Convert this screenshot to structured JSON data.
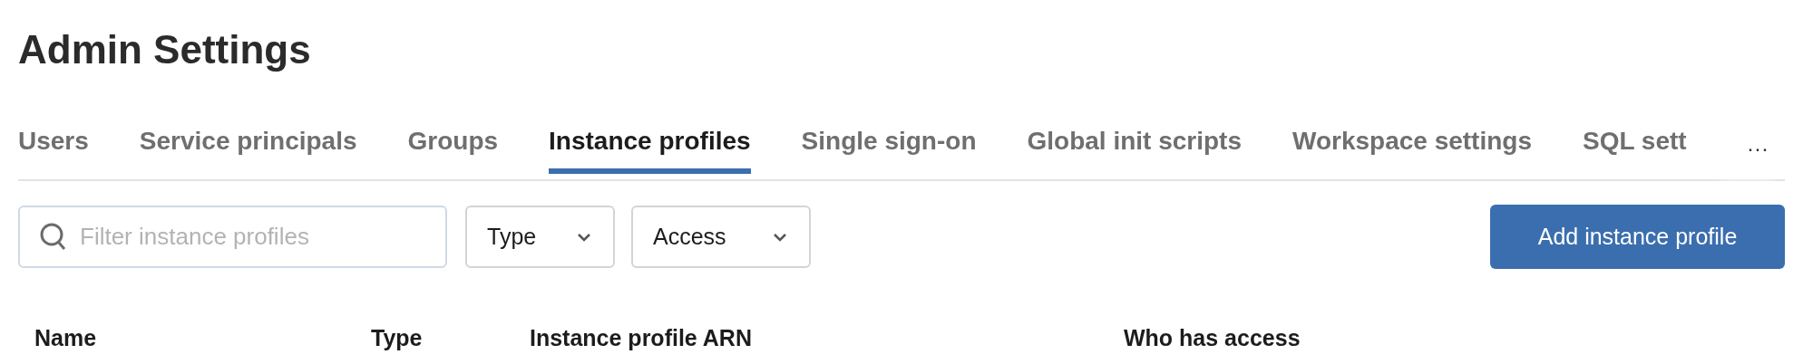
{
  "page": {
    "title": "Admin Settings"
  },
  "tabs": [
    {
      "label": "Users",
      "selected": false
    },
    {
      "label": "Service principals",
      "selected": false
    },
    {
      "label": "Groups",
      "selected": false
    },
    {
      "label": "Instance profiles",
      "selected": true
    },
    {
      "label": "Single sign-on",
      "selected": false
    },
    {
      "label": "Global init scripts",
      "selected": false
    },
    {
      "label": "Workspace settings",
      "selected": false
    },
    {
      "label": "SQL sett",
      "selected": false
    }
  ],
  "tabs_overflow": "···",
  "filter": {
    "placeholder": "Filter instance profiles"
  },
  "dropdowns": [
    {
      "label": "Type"
    },
    {
      "label": "Access"
    }
  ],
  "add_button": "Add instance profile",
  "table": {
    "columns": [
      "Name",
      "Type",
      "Instance profile ARN",
      "Who has access"
    ]
  }
}
